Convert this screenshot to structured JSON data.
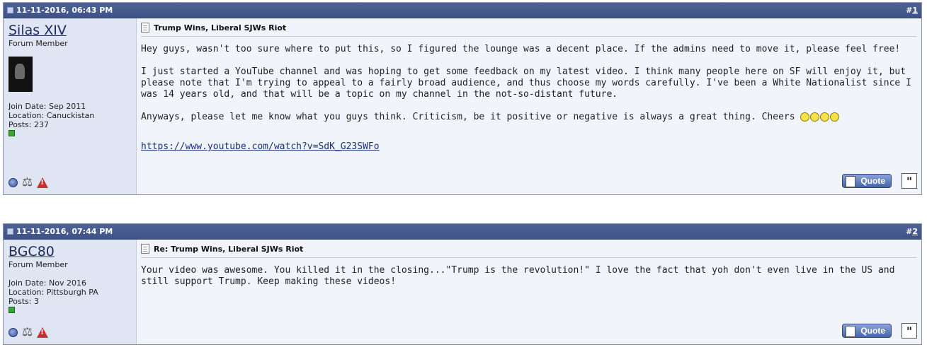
{
  "posts": [
    {
      "date": "11-11-2016, 06:43 PM",
      "number_prefix": "#",
      "number": "1",
      "username": "Silas XIV",
      "user_title": "Forum Member",
      "join_date": "Join Date: Sep 2011",
      "location": "Location: Canuckistan",
      "posts": "Posts: 237",
      "title": "Trump Wins, Liberal SJWs Riot",
      "paragraphs": [
        "Hey guys, wasn't too sure where to put this, so I figured the lounge was a decent place. If the admins need to move it, please feel free!",
        "I just started a YouTube channel and was hoping to get some feedback on my latest video. I think many people here on SF will enjoy it, but please note that I'm trying to appeal to a fairly broad audience, and thus choose my words carefully. I've been a White Nationalist since I was 14 years old, and that will be a topic on my channel in the not-so-distant future.",
        "Anyways, please let me know what you guys think. Criticism, be it positive or negative is always a great thing. Cheers"
      ],
      "link": "https://www.youtube.com/watch?v=SdK_G23SWFo",
      "quote_label": "Quote"
    },
    {
      "date": "11-11-2016, 07:44 PM",
      "number_prefix": "#",
      "number": "2",
      "username": "BGC80",
      "user_title": "Forum Member",
      "join_date": "Join Date: Nov 2016",
      "location": "Location: Pittsburgh PA",
      "posts": "Posts: 3",
      "title": "Re: Trump Wins, Liberal SJWs Riot",
      "paragraphs": [
        "Your video was awesome. You killed it in the closing...\"Trump is the revolution!\" I love the fact that yoh don't even live in the US and still support Trump. Keep making these videos!"
      ],
      "quote_label": "Quote"
    }
  ],
  "icons": {
    "status": "online-status-icon",
    "reputation": "reputation-icon",
    "report": "report-post-icon",
    "multi_quote": "multi-quote-icon"
  },
  "colors": {
    "header_bg": "#44578c",
    "userbox_bg": "#dfe5f2",
    "content_bg": "#f1f4fa",
    "link": "#1d2d7a"
  }
}
